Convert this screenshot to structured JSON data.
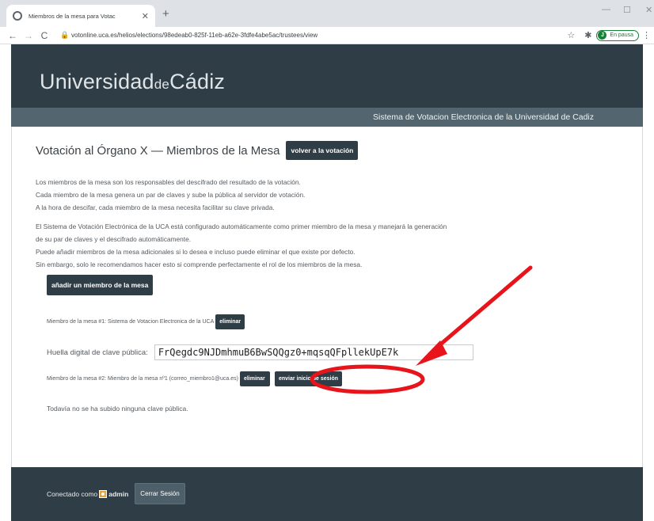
{
  "browser": {
    "tab_title": "Miembros de la mesa para Votac",
    "new_tab": "+",
    "url": "votonline.uca.es/helios/elections/98edeab0-825f-11eb-a62e-3fdfe4abe5ac/trustees/view",
    "profile_initial": "J",
    "profile_label": "En pausa"
  },
  "header": {
    "brand_main": "Universidad",
    "brand_de": "de",
    "brand_end": "Cádiz",
    "subtitle": "Sistema de Votacion Electronica de la Universidad de Cadiz"
  },
  "page": {
    "title": "Votación al Órgano X — Miembros de la Mesa",
    "back_button": "volver a la votación",
    "intro": [
      "Los miembros de la mesa son los responsables del descifrado del resultado de la votación.",
      "Cada miembro de la mesa genera un par de claves y sube la pública al servidor de votación.",
      "A la hora de descifar, cada miembro de la mesa necesita facilitar su clave privada."
    ],
    "info": [
      "El Sistema de Votación Electrónica de la UCA está configurado automáticamente como primer miembro de la mesa y manejará la generación",
      "de su par de claves y el descifrado automáticamente.",
      "Puede añadir miembros de la mesa adicionales si lo desea e incluso puede eliminar el que existe por defecto.",
      "Sin embargo, solo le recomendamos hacer esto si comprende perfectamente el rol de los miembros de la mesa."
    ],
    "add_button": "añadir un miembro de la mesa",
    "trustee1_text": "Miembro de la mesa #1: Sistema de Votacion Electronica de la UCA",
    "trustee1_delete": "eliminar",
    "fingerprint_label": "Huella digital de clave pública:",
    "fingerprint_value": "FrQegdc9NJDmhmuB6BwSQQgz0+mqsqQFpllekUpE7k",
    "trustee2_text": "Miembro de la mesa #2: Miembro de la mesa nº1 (correo_miembro1@uca.es)",
    "trustee2_delete": "eliminar",
    "trustee2_send": "enviar inicio de sesión",
    "no_key_text": "Todavía no se ha subido ninguna clave pública."
  },
  "footer": {
    "connected_as": "Conectado como",
    "username": "admin",
    "logout": "Cerrar Sesión"
  },
  "colors": {
    "header_bg": "#2f3e46",
    "subbar_bg": "#536670",
    "annotation_red": "#e8141b"
  }
}
